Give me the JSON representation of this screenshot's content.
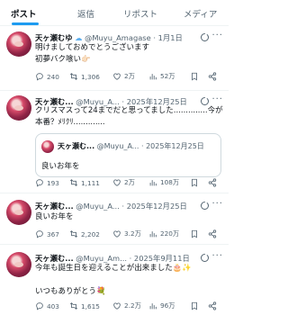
{
  "tabs": [
    "ポスト",
    "返信",
    "リポスト",
    "メディア"
  ],
  "posts": [
    {
      "name": "天ヶ瀬むゆ",
      "verified_badge": "☁",
      "handle": "@Muyu_Amagase",
      "sep": "·",
      "date": "1月1日",
      "lines": [
        "明けましておめでとうございます",
        "初夢バク喰い👉🏻"
      ],
      "replies": "240",
      "reposts": "1,306",
      "likes": "2万",
      "views": "52万"
    },
    {
      "name": "天ヶ瀬む...",
      "handle": "@Muyu_A...",
      "sep": "·",
      "date": "2025年12月25日",
      "lines": [
        "クリスマスって24までだと思ってました..............今が",
        "本番？ﾒﾘｸﾘ............."
      ],
      "quote": {
        "name": "天ヶ瀬む...",
        "handle": "@Muyu_A...",
        "sep": "·",
        "date": "2025年12月25日",
        "text": "良いお年を"
      },
      "replies": "193",
      "reposts": "1,111",
      "likes": "2万",
      "views": "108万"
    },
    {
      "name": "天ヶ瀬む...",
      "handle": "@Muyu_A...",
      "sep": "·",
      "date": "2025年12月25日",
      "lines": [
        "良いお年を"
      ],
      "replies": "367",
      "reposts": "2,202",
      "likes": "3.2万",
      "views": "220万"
    },
    {
      "name": "天ヶ瀬む...",
      "handle": "@Muyu_Am...",
      "sep": "·",
      "date": "2025年9月11日",
      "lines": [
        "今年も誕生日を迎えることが出来ました🎂✨",
        "",
        "いつもありがとう💐"
      ],
      "replies": "403",
      "reposts": "1,615",
      "likes": "2.2万",
      "views": "96万"
    }
  ],
  "more_glyph": "···",
  "colors": {
    "accent": "#1d9bf0",
    "text": "#0f1419",
    "muted": "#536471",
    "border": "#eff3f4"
  }
}
